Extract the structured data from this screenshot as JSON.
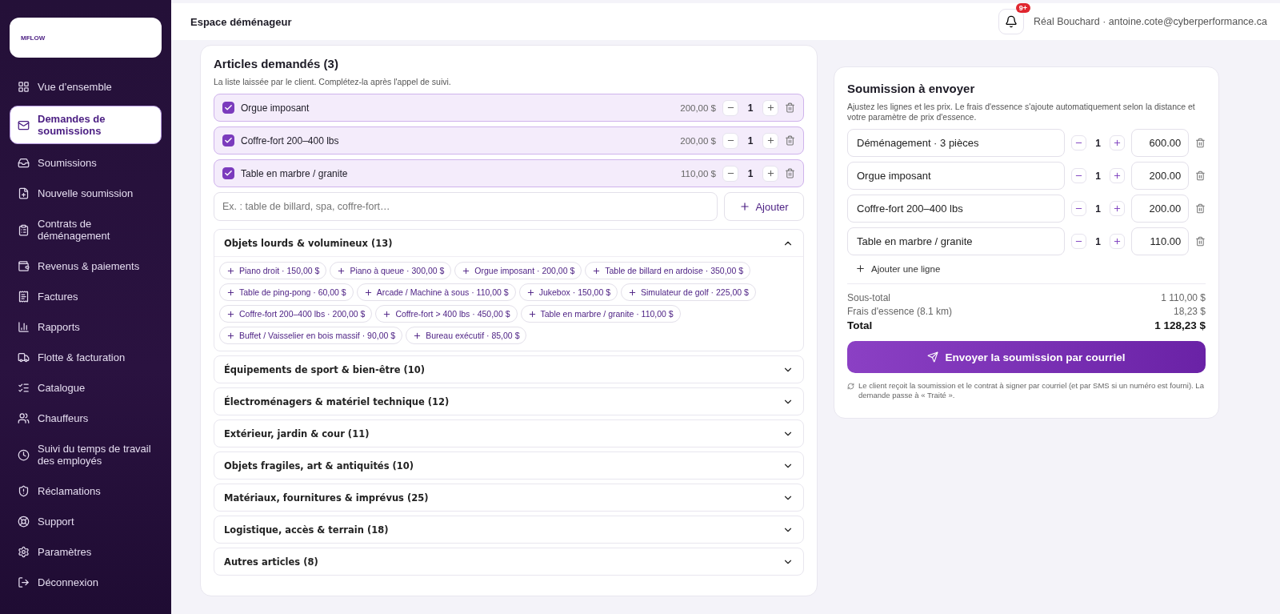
{
  "sidebar": {
    "logo": {
      "text": "MFLOW"
    },
    "items": [
      {
        "label": "Vue d’ensemble",
        "selected": false
      },
      {
        "label": "Demandes de soumissions",
        "selected": true
      },
      {
        "label": "Soumissions",
        "selected": false
      },
      {
        "label": "Nouvelle soumission",
        "selected": false
      },
      {
        "label": "Contrats de déménagement",
        "selected": false
      },
      {
        "label": "Revenus & paiements",
        "selected": false
      },
      {
        "label": "Factures",
        "selected": false
      },
      {
        "label": "Rapports",
        "selected": false
      },
      {
        "label": "Flotte & facturation",
        "selected": false
      },
      {
        "label": "Catalogue",
        "selected": false
      },
      {
        "label": "Chauffeurs",
        "selected": false
      },
      {
        "label": "Suivi du temps de travail des employés",
        "selected": false
      },
      {
        "label": "Réclamations",
        "selected": false
      },
      {
        "label": "Support",
        "selected": false
      },
      {
        "label": "Paramètres",
        "selected": false
      }
    ],
    "logout": "Déconnexion"
  },
  "header": {
    "title": "Espace déménageur",
    "notifications_badge": "9+",
    "user": "Réal Bouchard · antoine.cote@cyberperformance.ca"
  },
  "requested_items": {
    "title": "Articles demandés (3)",
    "subtitle": "La liste laissée par le client. Complétez-la après l'appel de suivi.",
    "items": [
      {
        "name": "Orgue imposant",
        "price": "200,00 $",
        "qty": "1",
        "checked": true
      },
      {
        "name": "Coffre-fort 200–400 lbs",
        "price": "200,00 $",
        "qty": "1",
        "checked": true
      },
      {
        "name": "Table en marbre / granite",
        "price": "110,00 $",
        "qty": "1",
        "checked": true
      }
    ],
    "add_field": {
      "placeholder": "Ex. : table de billard, spa, coffre-fort…"
    },
    "add_button": "Ajouter",
    "categories": [
      {
        "title": "Objets lourds & volumineux (13)",
        "expanded": true,
        "chips": [
          "Piano droit · 150,00 $",
          "Piano à queue · 300,00 $",
          "Orgue imposant · 200,00 $",
          "Table de billard en ardoise · 350,00 $",
          "Table de ping-pong · 60,00 $",
          "Arcade / Machine à sous · 110,00 $",
          "Jukebox · 150,00 $",
          "Simulateur de golf · 225,00 $",
          "Coffre-fort 200–400 lbs · 200,00 $",
          "Coffre-fort > 400 lbs · 450,00 $",
          "Table en marbre / granite · 110,00 $",
          "Buffet / Vaisselier en bois massif · 90,00 $",
          "Bureau exécutif · 85,00 $"
        ]
      },
      {
        "title": "Équipements de sport & bien-être (10)",
        "expanded": false
      },
      {
        "title": "Électroménagers & matériel technique (12)",
        "expanded": false
      },
      {
        "title": "Extérieur, jardin & cour (11)",
        "expanded": false
      },
      {
        "title": "Objets fragiles, art & antiquités (10)",
        "expanded": false
      },
      {
        "title": "Matériaux, fournitures & imprévus (25)",
        "expanded": false
      },
      {
        "title": "Logistique, accès & terrain (18)",
        "expanded": false
      },
      {
        "title": "Autres articles (8)",
        "expanded": false
      }
    ]
  },
  "quote": {
    "title": "Soumission à envoyer",
    "subtitle": "Ajustez les lignes et les prix. Le frais d'essence s'ajoute automatiquement selon la distance et votre paramètre de prix d'essence.",
    "lines": [
      {
        "name": "Déménagement · 3 pièces",
        "qty": "1",
        "price": "600.00"
      },
      {
        "name": "Orgue imposant",
        "qty": "1",
        "price": "200.00"
      },
      {
        "name": "Coffre-fort 200–400 lbs",
        "qty": "1",
        "price": "200.00"
      },
      {
        "name": "Table en marbre / granite",
        "qty": "1",
        "price": "110.00"
      }
    ],
    "add_line": "Ajouter une ligne",
    "totals": [
      {
        "label": "Sous-total",
        "value": "1 110,00 $",
        "kind": "normal"
      },
      {
        "label": "Frais d'essence (8.1 km)",
        "value": "18,23 $",
        "kind": "normal"
      },
      {
        "label": "Total",
        "value": "1 128,23 $",
        "kind": "grand"
      }
    ],
    "send_button": "Envoyer la soumission par courriel",
    "note": "Le client reçoit la soumission et le contrat à signer par courriel (et par SMS si un numéro est fourni). La demande passe à « Traité »."
  }
}
